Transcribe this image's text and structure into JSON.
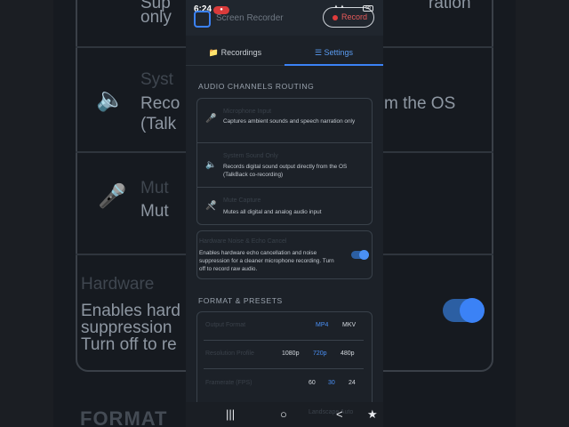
{
  "background": {
    "row1_text_line1": "Sup",
    "row1_text_line2": "only",
    "row1_right": "ration",
    "row2_text_line1": "Reco",
    "row2_text_line2": "(Talk",
    "row2_right": "m the OS",
    "row3_text": "Mut",
    "echo_line1": "Enables hard",
    "echo_line2": "suppression",
    "echo_line3": "Turn off to re",
    "section": "FORMAT",
    "speaker_icon": "speaker-icon",
    "mic_off_icon": "mic-off-icon"
  },
  "status_bar": {
    "time": "6:24",
    "battery": "68"
  },
  "header": {
    "app_title": "Screen Recorder",
    "record_label": "Record",
    "record_color": "#e03c3c"
  },
  "tabs": {
    "recordings": "Recordings",
    "settings": "Settings",
    "active": "settings",
    "accent": "#3b82f6"
  },
  "audio": {
    "section_title": "AUDIO CHANNELS ROUTING",
    "options": [
      {
        "title": "Microphone Input",
        "desc": "Captures ambient sounds and speech narration only",
        "icon": "mic-icon"
      },
      {
        "title": "System Sound Only",
        "desc": "Records digital sound output directly from the OS (TalkBack co-recording)",
        "icon": "speaker-icon"
      },
      {
        "title": "Mute Capture",
        "desc": "Mutes all digital and analog audio input",
        "icon": "mic-off-icon"
      }
    ],
    "echo": {
      "title": "Hardware Noise & Echo Cancel",
      "desc": "Enables hardware echo cancellation and noise suppression for a cleaner microphone recording. Turn off to record raw audio.",
      "enabled": true
    }
  },
  "format": {
    "section_title": "FORMAT & PRESETS",
    "rows": [
      {
        "label": "Output Format",
        "options": [
          "MP4",
          "MKV"
        ],
        "selected": "MP4"
      },
      {
        "label": "Resolution Profile",
        "options": [
          "1080p",
          "720p",
          "480p"
        ],
        "selected": "720p"
      },
      {
        "label": "Framerate (FPS)",
        "options": [
          "60",
          "30",
          "24"
        ],
        "selected": "30"
      }
    ],
    "orientation_hint": "Landscape  Auto"
  }
}
